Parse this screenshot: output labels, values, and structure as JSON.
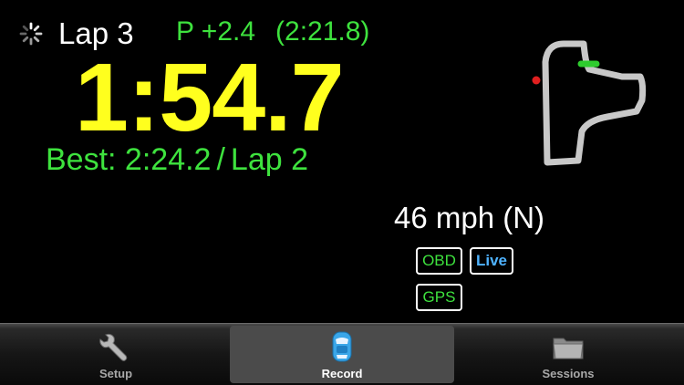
{
  "header": {
    "lap_label": "Lap 3",
    "delta": "P +2.4",
    "predicted": "(2:21.8)"
  },
  "timer": {
    "current": "1:54.7"
  },
  "best": {
    "label": "Best: 2:24.2",
    "separator": "/",
    "lap": "Lap 2"
  },
  "speed": {
    "text": "46 mph (N)"
  },
  "badges": {
    "obd": "OBD",
    "live": "Live",
    "gps": "GPS"
  },
  "track_map": {
    "start_marker_color": "#e01f1f",
    "position_marker_color": "#2ecc2e",
    "track_color": "#c8c8c8"
  },
  "tabs": [
    {
      "label": "Setup",
      "icon": "wrench-icon"
    },
    {
      "label": "Record",
      "icon": "car-icon",
      "selected": true
    },
    {
      "label": "Sessions",
      "icon": "folder-icon"
    }
  ],
  "colors": {
    "time": "#ffff1e",
    "green": "#3ee23e",
    "live_blue": "#4fb3ff"
  }
}
